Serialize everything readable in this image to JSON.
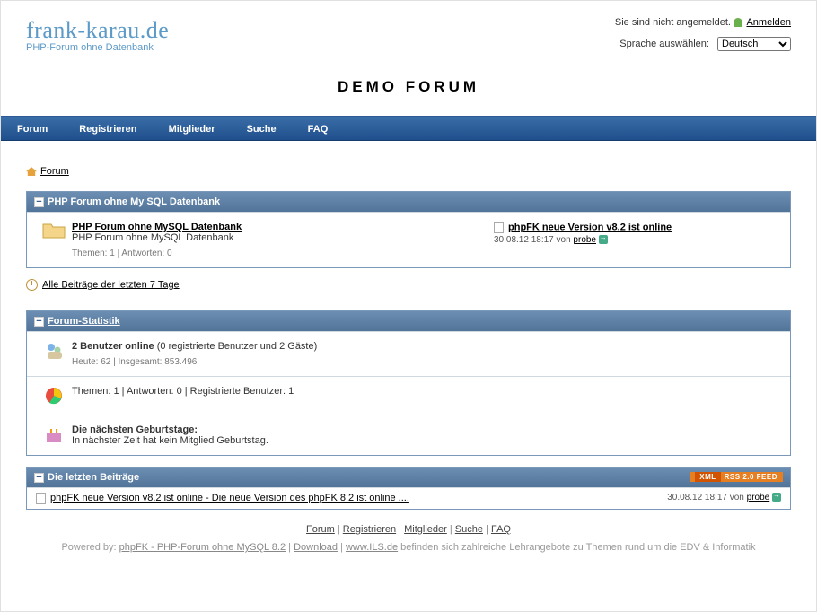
{
  "header": {
    "not_logged": "Sie sind nicht angemeldet.",
    "login_link": "Anmelden",
    "lang_label": "Sprache auswählen:",
    "lang_value": "Deutsch",
    "logo": "frank-karau.de",
    "tagline": "PHP-Forum ohne Datenbank",
    "demo_title": "DEMO FORUM"
  },
  "nav": {
    "forum": "Forum",
    "register": "Registrieren",
    "members": "Mitglieder",
    "search": "Suche",
    "faq": "FAQ"
  },
  "breadcrumb": "Forum",
  "category": {
    "title": "PHP Forum ohne My SQL Datenbank",
    "forum_name": "PHP Forum ohne MySQL Datenbank",
    "forum_desc": "PHP Forum ohne MySQL Datenbank",
    "stats": "Themen: 1 | Antworten: 0",
    "last_topic": "phpFK neue Version v8.2 ist online",
    "last_date": "30.08.12 18:17",
    "last_by": "von",
    "last_user": "probe"
  },
  "recent_link": "Alle Beiträge der letzten 7 Tage",
  "stats": {
    "title": "Forum-Statistik",
    "online_bold": "2 Benutzer online",
    "online_rest": " (0 registrierte Benutzer und 2 Gäste)",
    "today": "Heute: 62 | Insgesamt: 853.496",
    "counts": "Themen: 1 | Antworten: 0 | Registrierte Benutzer: 1",
    "bday_head": "Die nächsten Geburtstage:",
    "bday_text": "In nächster Zeit hat kein Mitglied Geburtstag."
  },
  "latest": {
    "title": "Die letzten Beiträge",
    "rss_xml": "XML",
    "rss_feed": "RSS 2.0 FEED",
    "post": "phpFK neue Version v8.2 ist online - Die neue Version des phpFK 8.2 ist online ....",
    "date": "30.08.12 18:17",
    "by": "von",
    "user": "probe"
  },
  "footer": {
    "sep": " | ",
    "powered_pre": "Powered by: ",
    "powered_app": "phpFK - PHP-Forum ohne MySQL 8.2",
    "download": "Download",
    "ils": "www.ILS.de",
    "ils_text": " befinden sich zahlreiche Lehrangebote zu Themen rund um die EDV & Informatik"
  }
}
